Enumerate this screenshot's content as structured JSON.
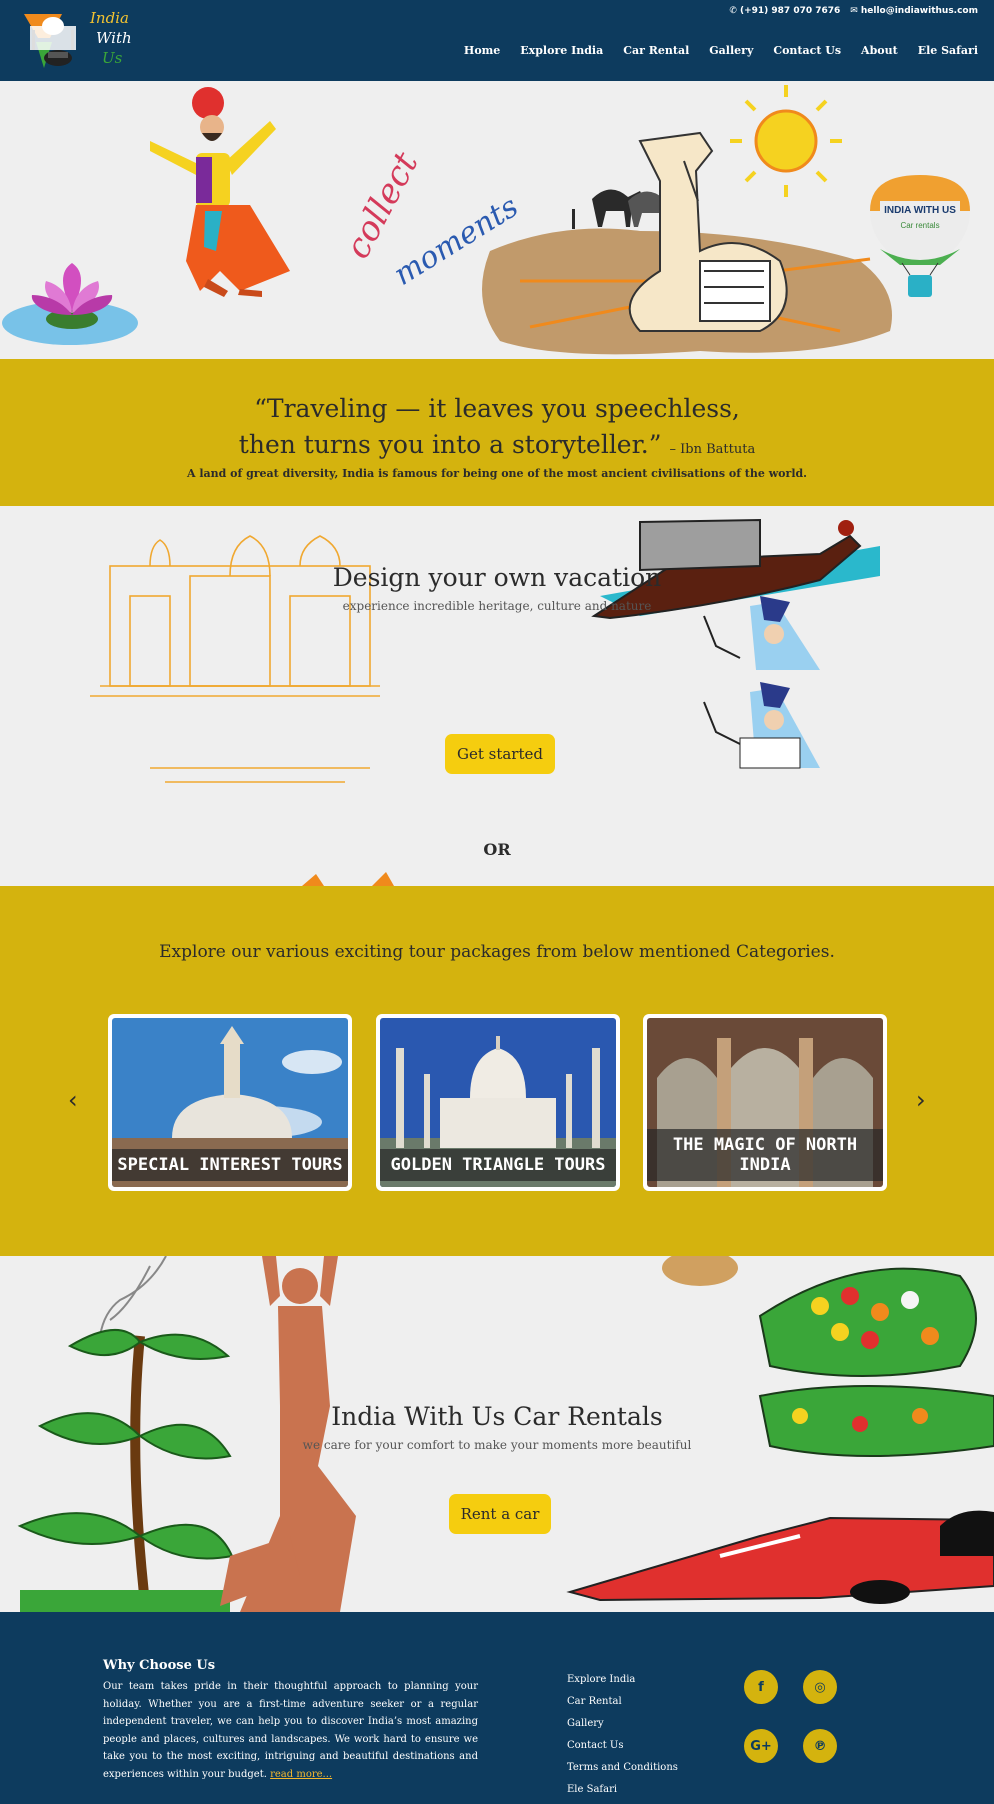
{
  "header": {
    "logo_lines": [
      "India",
      "With",
      "Us"
    ],
    "phone": "(+91) 987 070 7676",
    "email": "hello@indiawithus.com",
    "nav": [
      "Home",
      "Explore India",
      "Car Rental",
      "Gallery",
      "Contact Us",
      "About",
      "Ele Safari"
    ]
  },
  "hero": {
    "lettering": [
      "collect",
      "moments"
    ],
    "balloon_text": [
      "INDIA WITH US",
      "Car rentals"
    ]
  },
  "quote": {
    "line1": "“Traveling — it leaves you speechless,",
    "line2": "then turns you into a storyteller.”",
    "author": "– Ibn Battuta",
    "subtitle": "A land of great diversity, India is famous for being one of the most ancient civilisations of the world."
  },
  "design": {
    "title": "Design your own vacation",
    "subtitle": "experience incredible heritage, culture and nature",
    "button": "Get started",
    "or": "OR"
  },
  "tours": {
    "title": "Explore our various exciting tour packages from below mentioned Categories.",
    "prev": "‹",
    "next": "›",
    "cards": [
      {
        "label": "SPECIAL INTEREST TOURS"
      },
      {
        "label": "GOLDEN TRIANGLE TOURS"
      },
      {
        "label": "THE MAGIC OF NORTH INDIA"
      }
    ]
  },
  "rental": {
    "title": "India With Us Car Rentals",
    "subtitle": "we care for your comfort to make your moments more beautiful",
    "button": "Rent a car"
  },
  "footer": {
    "why_title": "Why Choose Us",
    "why_text": "Our team takes pride in their thoughtful approach to planning your holiday. Whether you are a first-time adventure seeker or a regular independent traveler, we can help you to discover India’s most amazing people and places, cultures and landscapes. We work hard to ensure we take you to the most exciting, intriguing and beautiful destinations and experiences within your budget.",
    "read_more": "read more...",
    "links": [
      "Explore India",
      "Car Rental",
      "Gallery",
      "Contact Us",
      "Terms and Conditions",
      "Ele Safari"
    ],
    "social": [
      {
        "icon": "facebook-icon",
        "glyph": "f"
      },
      {
        "icon": "instagram-icon",
        "glyph": "◎"
      },
      {
        "icon": "google-plus-icon",
        "glyph": "G+"
      },
      {
        "icon": "pinterest-icon",
        "glyph": "℗"
      }
    ]
  },
  "colors": {
    "navy": "#0d3b5e",
    "mustard": "#d4b30e",
    "button_yellow": "#f5cd0f",
    "background": "#efefef"
  }
}
